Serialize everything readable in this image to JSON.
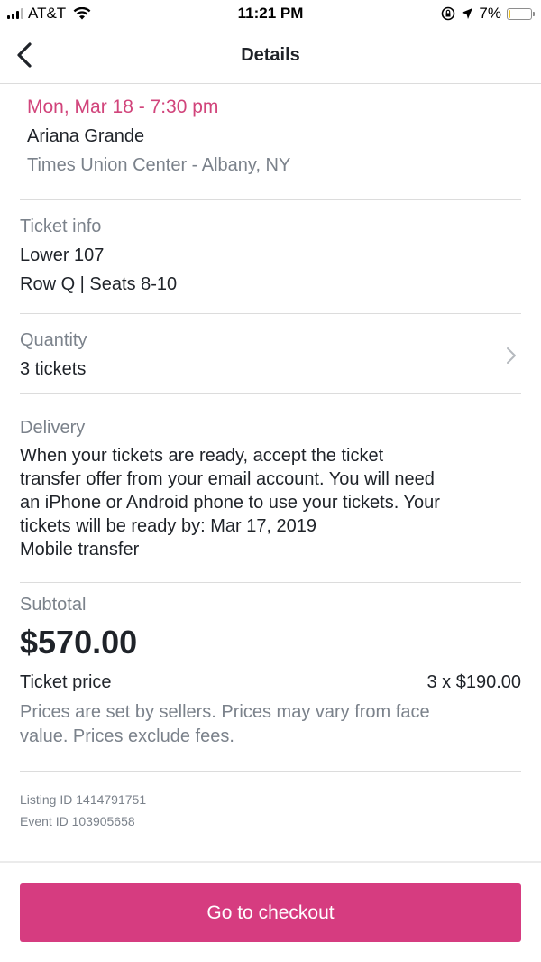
{
  "status_bar": {
    "carrier": "AT&T",
    "time": "11:21 PM",
    "battery_percent": "7%",
    "battery_level": 0.07,
    "battery_color": "#f2c31a"
  },
  "nav": {
    "title": "Details",
    "back_icon": "chevron-left-icon"
  },
  "event": {
    "date_time": "Mon, Mar 18 - 7:30 pm",
    "performer": "Ariana Grande",
    "venue": "Times Union Center - Albany, NY"
  },
  "ticket_info": {
    "label": "Ticket info",
    "section": "Lower 107",
    "row_seats": "Row Q | Seats 8-10"
  },
  "quantity": {
    "label": "Quantity",
    "value": "3 tickets"
  },
  "delivery": {
    "label": "Delivery",
    "line1": "When your tickets are ready, accept the ticket",
    "line2": "transfer offer from your email account. You will need",
    "line3": "an iPhone or Android phone to use your tickets. Your",
    "line4": "tickets will be ready by: Mar 17, 2019",
    "method": "Mobile transfer"
  },
  "subtotal": {
    "label": "Subtotal",
    "amount": "$570.00",
    "ticket_price_label": "Ticket price",
    "ticket_price_value": "3 x $190.00",
    "note_line1": "Prices are set by sellers. Prices may vary from face",
    "note_line2": "value. Prices exclude fees."
  },
  "ids": {
    "listing": "Listing ID 1414791751",
    "event": "Event ID 103905658"
  },
  "checkout": {
    "label": "Go to checkout",
    "color": "#d63c80"
  },
  "colors": {
    "accent_pink": "#d1447b",
    "muted_text": "#7b828b"
  }
}
